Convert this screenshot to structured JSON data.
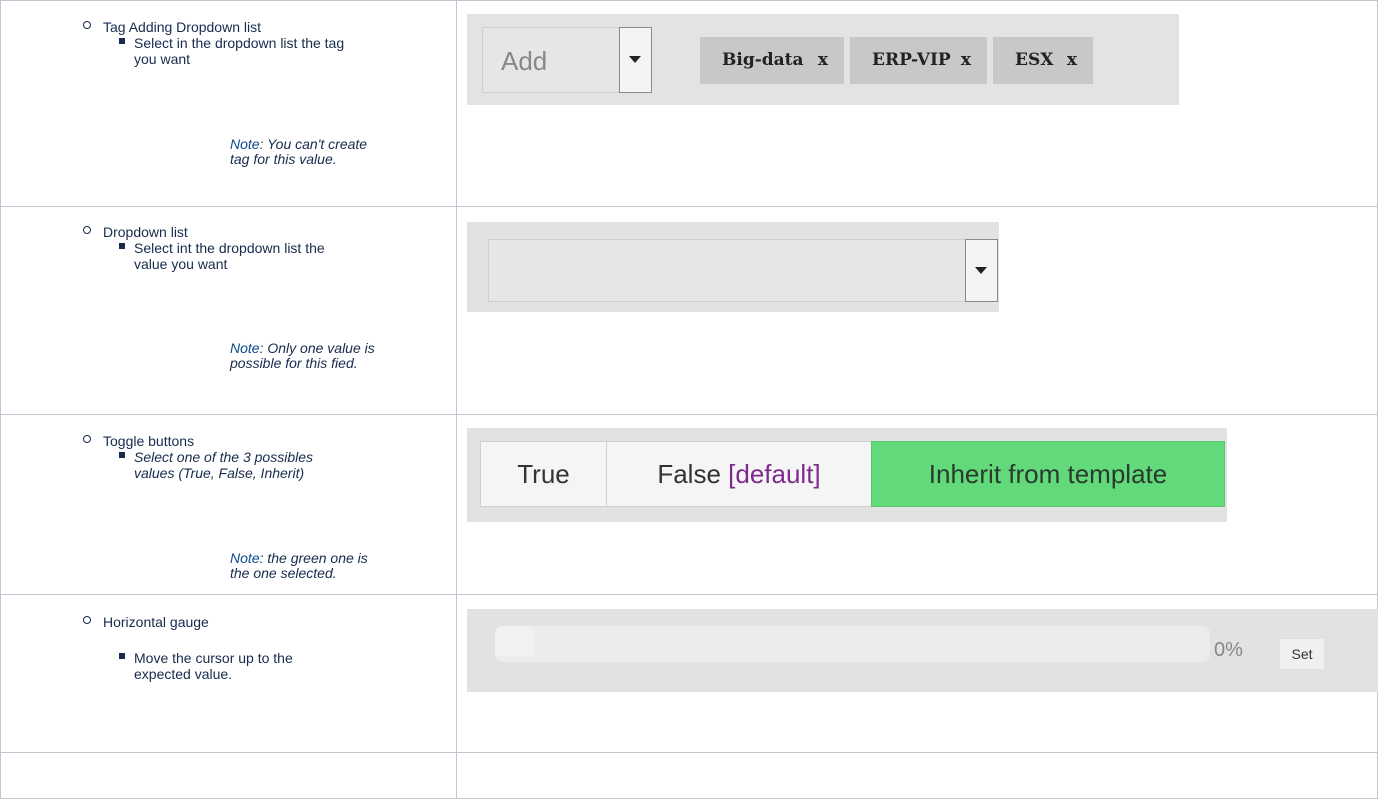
{
  "rows": [
    {
      "title": "Tag Adding Dropdown list",
      "sub": "Select in the dropdown list the tag you want",
      "note_word": "Note",
      "note_rest": ": You can't create tag for this value.",
      "widget": {
        "add_label": "Add",
        "tags": [
          {
            "label": "Big-data",
            "remove": "x"
          },
          {
            "label": "ERP-VIP",
            "remove": "x"
          },
          {
            "label": "ESX",
            "remove": "x"
          }
        ]
      }
    },
    {
      "title": "Dropdown list",
      "sub": "Select int the dropdown list the value you want",
      "note_word": "Note",
      "note_rest": ": Only one value is possible for this fied.",
      "widget": {
        "selected_value": ""
      }
    },
    {
      "title": "Toggle buttons",
      "sub": "Select one of the 3 possibles values (True, False, Inherit)",
      "note_word": "Note",
      "note_rest": ": the green one is the one selected.",
      "widget": {
        "options": [
          "True",
          "False ",
          "Inherit from template"
        ],
        "default_marker": "[default]",
        "selected": "Inherit from template",
        "selected_color": "#62d97a"
      }
    },
    {
      "title": "Horizontal gauge",
      "sub": "Move the cursor up to the expected value.",
      "widget": {
        "value_text": "0%",
        "value": 0,
        "set_label": "Set"
      }
    }
  ]
}
